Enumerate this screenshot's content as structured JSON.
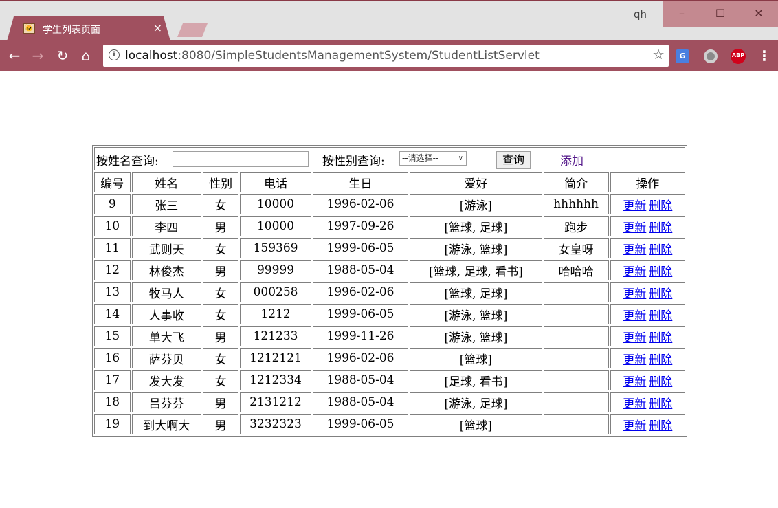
{
  "browser": {
    "tab_title": "学生列表页面",
    "tab_close": "×",
    "profile_name": "qh",
    "url_host": "localhost",
    "url_rest": ":8080/SimpleStudentsManagementSystem/StudentListServlet",
    "window_controls": {
      "minimize": "–",
      "maximize": "☐",
      "close": "✕"
    },
    "accent_color": "#a0505f",
    "extensions": [
      "translate-icon",
      "circle-extension-icon",
      "adblock-plus-icon"
    ],
    "abp_label": "ABP"
  },
  "search": {
    "name_label": "按姓名查询:",
    "name_value": "",
    "gender_label": "按性别查询:",
    "gender_selected": "--请选择--",
    "query_button": "查询",
    "add_link": "添加"
  },
  "table": {
    "headers": [
      "编号",
      "姓名",
      "性别",
      "电话",
      "生日",
      "爱好",
      "简介",
      "操作"
    ],
    "update_label": "更新",
    "delete_label": "删除",
    "rows": [
      [
        "9",
        "张三",
        "女",
        "10000",
        "1996-02-06",
        "[游泳]",
        "hhhhhh"
      ],
      [
        "10",
        "李四",
        "男",
        "10000",
        "1997-09-26",
        "[篮球, 足球]",
        "跑步"
      ],
      [
        "11",
        "武则天",
        "女",
        "159369",
        "1999-06-05",
        "[游泳, 篮球]",
        "女皇呀"
      ],
      [
        "12",
        "林俊杰",
        "男",
        "99999",
        "1988-05-04",
        "[篮球, 足球, 看书]",
        "哈哈哈"
      ],
      [
        "13",
        "牧马人",
        "女",
        "000258",
        "1996-02-06",
        "[篮球, 足球]",
        ""
      ],
      [
        "14",
        "人事收",
        "女",
        "1212",
        "1999-06-05",
        "[游泳, 篮球]",
        ""
      ],
      [
        "15",
        "单大飞",
        "男",
        "121233",
        "1999-11-26",
        "[游泳, 篮球]",
        ""
      ],
      [
        "16",
        "萨芬贝",
        "女",
        "1212121",
        "1996-02-06",
        "[篮球]",
        ""
      ],
      [
        "17",
        "发大发",
        "女",
        "1212334",
        "1988-05-04",
        "[足球, 看书]",
        ""
      ],
      [
        "18",
        "吕芬芬",
        "男",
        "2131212",
        "1988-05-04",
        "[游泳, 足球]",
        ""
      ],
      [
        "19",
        "到大啊大",
        "男",
        "3232323",
        "1999-06-05",
        "[篮球]",
        ""
      ]
    ]
  }
}
